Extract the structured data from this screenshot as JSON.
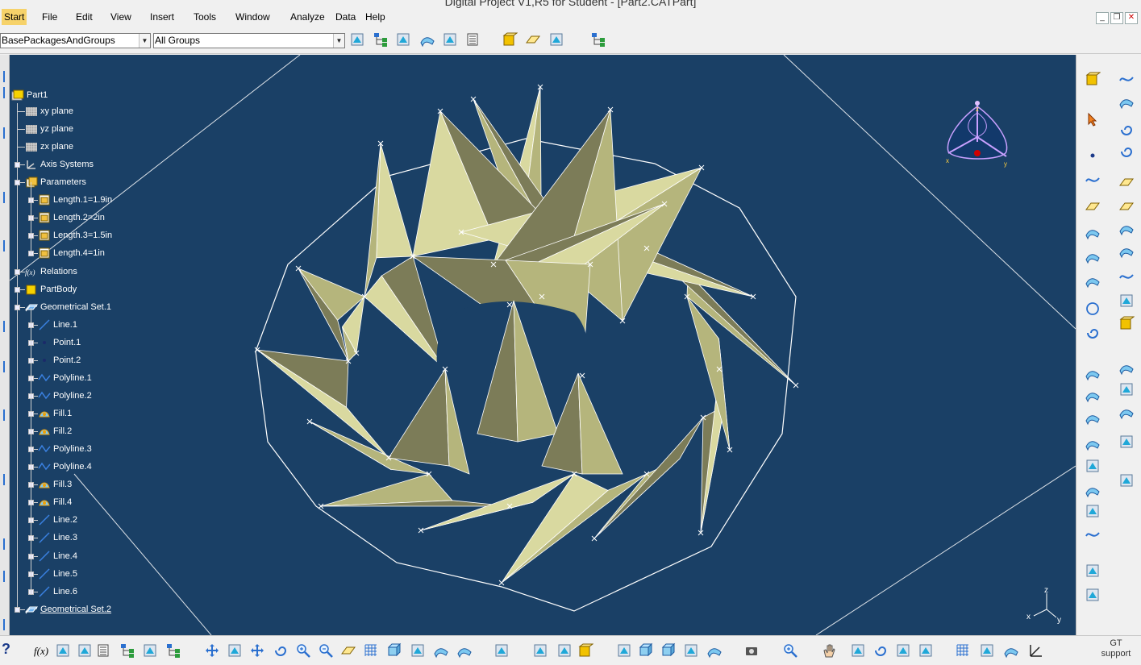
{
  "window": {
    "title": "Digital Project V1,R5 for Student - [Part2.CATPart]",
    "controls": {
      "minimize": "_",
      "restore": "❐",
      "close": "✕"
    }
  },
  "menu": [
    {
      "label": "Start",
      "active": true
    },
    {
      "label": "File"
    },
    {
      "label": "Edit"
    },
    {
      "label": "View"
    },
    {
      "label": "Insert"
    },
    {
      "label": "Tools"
    },
    {
      "label": "Window"
    },
    {
      "label": "Analyze"
    },
    {
      "label": "Data"
    },
    {
      "label": "Help"
    }
  ],
  "toolbar": {
    "package_filter": "BasePackagesAndGroups",
    "group_filter": "All Groups"
  },
  "tree": {
    "root": "Part1",
    "nodes": [
      {
        "label": "xy plane",
        "icon": "plane-icon"
      },
      {
        "label": "yz plane",
        "icon": "plane-icon"
      },
      {
        "label": "zx plane",
        "icon": "plane-icon"
      },
      {
        "label": "Axis Systems",
        "icon": "axis-system-icon"
      },
      {
        "label": "Parameters",
        "icon": "parameters-icon"
      },
      {
        "label": "Length.1=1.9in",
        "icon": "length-parameter-icon"
      },
      {
        "label": "Length.2=2in",
        "icon": "length-parameter-icon"
      },
      {
        "label": "Length.3=1.5in",
        "icon": "length-parameter-icon"
      },
      {
        "label": "Length.4=1in",
        "icon": "length-parameter-icon"
      },
      {
        "label": "Relations",
        "icon": "relations-icon"
      },
      {
        "label": "PartBody",
        "icon": "part-body-icon"
      },
      {
        "label": "Geometrical Set.1",
        "icon": "geometrical-set-icon"
      },
      {
        "label": "Line.1",
        "icon": "line-icon"
      },
      {
        "label": "Point.1",
        "icon": "point-icon"
      },
      {
        "label": "Point.2",
        "icon": "point-icon"
      },
      {
        "label": "Polyline.1",
        "icon": "polyline-icon"
      },
      {
        "label": "Polyline.2",
        "icon": "polyline-icon"
      },
      {
        "label": "Fill.1",
        "icon": "fill-icon"
      },
      {
        "label": "Fill.2",
        "icon": "fill-icon"
      },
      {
        "label": "Polyline.3",
        "icon": "polyline-icon"
      },
      {
        "label": "Polyline.4",
        "icon": "polyline-icon"
      },
      {
        "label": "Fill.3",
        "icon": "fill-icon"
      },
      {
        "label": "Fill.4",
        "icon": "fill-icon"
      },
      {
        "label": "Line.2",
        "icon": "line-icon"
      },
      {
        "label": "Line.3",
        "icon": "line-icon"
      },
      {
        "label": "Line.4",
        "icon": "line-icon"
      },
      {
        "label": "Line.5",
        "icon": "line-icon"
      },
      {
        "label": "Line.6",
        "icon": "line-icon"
      },
      {
        "label": "Geometrical Set.2",
        "icon": "geometrical-set-icon"
      }
    ]
  },
  "compass": {
    "axes": {
      "x": "x",
      "y": "y",
      "z": "z"
    }
  },
  "axis_triad": {
    "x": "x",
    "y": "y",
    "z": "z"
  },
  "status": {
    "support_label": "GT\nsupport",
    "help_icon": "?"
  },
  "colors": {
    "viewport_bg": "#1a4066",
    "surface_light": "#d9d9a0",
    "surface_mid": "#b5b57c",
    "surface_dark": "#7c7c58",
    "edge": "#ffffff",
    "menu_active": "#f6d26a"
  }
}
